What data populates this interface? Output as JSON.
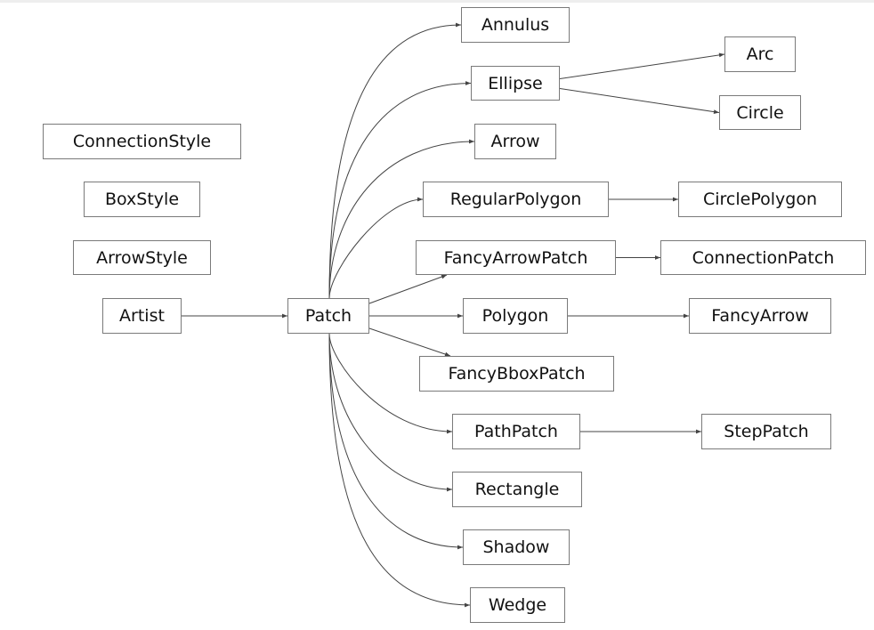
{
  "diagram": {
    "type": "class-inheritance-graph",
    "line_color": "#444444",
    "nodes": {
      "ConnectionStyle": "ConnectionStyle",
      "BoxStyle": "BoxStyle",
      "ArrowStyle": "ArrowStyle",
      "Artist": "Artist",
      "Patch": "Patch",
      "Annulus": "Annulus",
      "Ellipse": "Ellipse",
      "Arrow": "Arrow",
      "RegularPolygon": "RegularPolygon",
      "FancyArrowPatch": "FancyArrowPatch",
      "Polygon": "Polygon",
      "FancyBboxPatch": "FancyBboxPatch",
      "PathPatch": "PathPatch",
      "Rectangle": "Rectangle",
      "Shadow": "Shadow",
      "Wedge": "Wedge",
      "Arc": "Arc",
      "Circle": "Circle",
      "CirclePolygon": "CirclePolygon",
      "ConnectionPatch": "ConnectionPatch",
      "FancyArrow": "FancyArrow",
      "StepPatch": "StepPatch"
    },
    "edges": [
      [
        "Artist",
        "Patch"
      ],
      [
        "Patch",
        "Annulus"
      ],
      [
        "Patch",
        "Ellipse"
      ],
      [
        "Patch",
        "Arrow"
      ],
      [
        "Patch",
        "RegularPolygon"
      ],
      [
        "Patch",
        "FancyArrowPatch"
      ],
      [
        "Patch",
        "Polygon"
      ],
      [
        "Patch",
        "FancyBboxPatch"
      ],
      [
        "Patch",
        "PathPatch"
      ],
      [
        "Patch",
        "Rectangle"
      ],
      [
        "Patch",
        "Shadow"
      ],
      [
        "Patch",
        "Wedge"
      ],
      [
        "Ellipse",
        "Arc"
      ],
      [
        "Ellipse",
        "Circle"
      ],
      [
        "RegularPolygon",
        "CirclePolygon"
      ],
      [
        "FancyArrowPatch",
        "ConnectionPatch"
      ],
      [
        "Polygon",
        "FancyArrow"
      ],
      [
        "PathPatch",
        "StepPatch"
      ]
    ]
  }
}
